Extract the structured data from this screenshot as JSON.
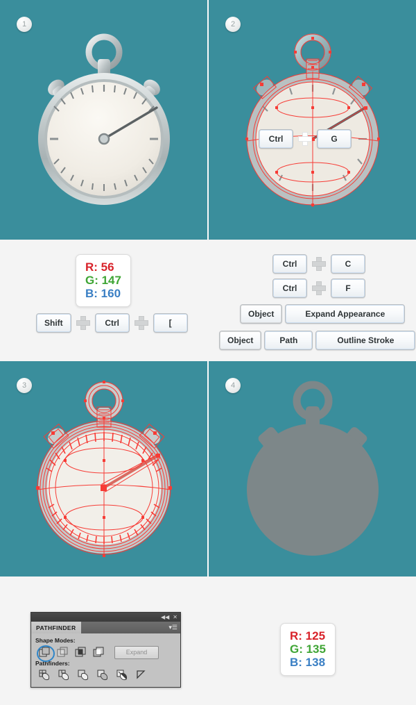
{
  "meta": {
    "teal_background": "#3a8e9c",
    "light_background": "#f4f4f4",
    "silhouette_color": "#7d8789"
  },
  "steps": [
    {
      "badge": "1",
      "name": "stopwatch-rendered"
    },
    {
      "badge": "2",
      "name": "stopwatch-selected-paths"
    },
    {
      "badge": "3",
      "name": "stopwatch-outlined-strokes"
    },
    {
      "badge": "4",
      "name": "stopwatch-silhouette"
    }
  ],
  "panel2_overlay": {
    "keys": [
      "Ctrl",
      "G"
    ]
  },
  "section_one": {
    "rgb_card": {
      "r_label": "R: 56",
      "g_label": "G: 147",
      "b_label": "B: 160",
      "r": 56,
      "g": 147,
      "b": 160
    },
    "shortcut": {
      "keys": [
        "Shift",
        "Ctrl",
        "["
      ]
    }
  },
  "section_two": {
    "shortcut_one": {
      "keys": [
        "Ctrl",
        "C"
      ]
    },
    "shortcut_two": {
      "keys": [
        "Ctrl",
        "F"
      ]
    },
    "menu_one": {
      "items": [
        "Object",
        "Expand Appearance"
      ]
    },
    "menu_two": {
      "items": [
        "Object",
        "Path",
        "Outline Stroke"
      ]
    }
  },
  "section_three": {
    "pathfinder": {
      "title": "PATHFINDER",
      "collapse_icon": "◀◀",
      "close_icon": "✕",
      "menu_icon": "▾☰",
      "shape_modes_label": "Shape Modes:",
      "shape_modes": [
        {
          "name": "unite",
          "selected": true
        },
        {
          "name": "minus-front",
          "selected": false
        },
        {
          "name": "intersect",
          "selected": false
        },
        {
          "name": "exclude",
          "selected": false
        }
      ],
      "expand_label": "Expand",
      "pathfinders_label": "Pathfinders:",
      "pathfinders": [
        {
          "name": "divide"
        },
        {
          "name": "trim"
        },
        {
          "name": "merge"
        },
        {
          "name": "crop"
        },
        {
          "name": "outline"
        },
        {
          "name": "minus-back"
        }
      ]
    },
    "rgb_card": {
      "r_label": "R: 125",
      "g_label": "G: 135",
      "b_label": "B: 138",
      "r": 125,
      "g": 135,
      "b": 138
    }
  }
}
